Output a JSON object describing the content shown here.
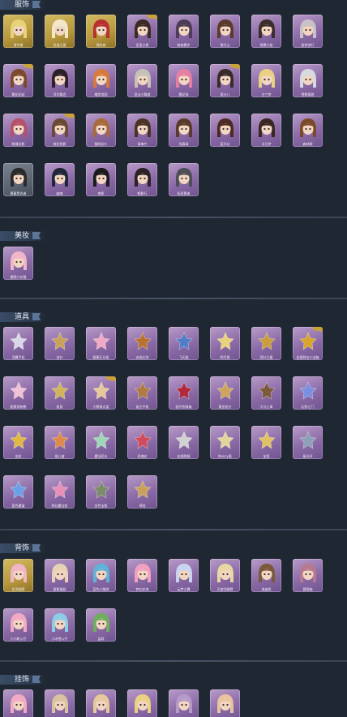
{
  "sections": [
    {
      "title": "服饰",
      "items": [
        {
          "label": "清华黛",
          "frame": "gold",
          "art": "costume",
          "hair": "#e7d27a",
          "badge": false
        },
        {
          "label": "圣诞之喜",
          "frame": "gold",
          "art": "costume",
          "hair": "#f3e7c9",
          "badge": false
        },
        {
          "label": "锦衣夜",
          "frame": "gold",
          "art": "costume",
          "hair": "#b8302f",
          "badge": false
        },
        {
          "label": "亚里沙星",
          "frame": "purple",
          "art": "costume",
          "hair": "#3b2b22",
          "badge": true
        },
        {
          "label": "暗夜舞步",
          "frame": "purple",
          "art": "costume",
          "hair": "#4d3c55",
          "badge": false
        },
        {
          "label": "雪月山",
          "frame": "purple",
          "art": "costume",
          "hair": "#5a3a2a",
          "badge": false
        },
        {
          "label": "猎鹰小姐",
          "frame": "purple",
          "art": "costume",
          "hair": "#3a2d2a",
          "badge": false
        },
        {
          "label": "甜梦游行",
          "frame": "purple",
          "art": "costume",
          "hair": "#c8c1c7",
          "badge": false
        },
        {
          "label": "繁花初绽",
          "frame": "purple",
          "art": "costume",
          "hair": "#7b4a2d",
          "badge": true
        },
        {
          "label": "浮华舞会",
          "frame": "purple",
          "art": "costume",
          "hair": "#2b2028",
          "badge": false
        },
        {
          "label": "橘梦游园",
          "frame": "purple",
          "art": "costume",
          "hair": "#d97a3d",
          "badge": false
        },
        {
          "label": "圣洁小舞娘",
          "frame": "purple",
          "art": "costume",
          "hair": "#c5c1b8",
          "badge": false
        },
        {
          "label": "樱花洛",
          "frame": "purple",
          "art": "costume",
          "hair": "#e47fa3",
          "badge": false
        },
        {
          "label": "诡计八",
          "frame": "purple",
          "art": "costume",
          "hair": "#3a2b2b",
          "badge": true
        },
        {
          "label": "白兰梦",
          "frame": "purple",
          "art": "costume",
          "hair": "#e9d083",
          "badge": false
        },
        {
          "label": "雪影狐娘",
          "frame": "purple",
          "art": "costume",
          "hair": "#d6d9e0",
          "badge": false
        },
        {
          "label": "粉蝶花影",
          "frame": "purple",
          "art": "costume",
          "hair": "#b5516b",
          "badge": false
        },
        {
          "label": "绒毛兔影",
          "frame": "purple",
          "art": "costume",
          "hair": "#6a4a33",
          "badge": true
        },
        {
          "label": "猫咪女仆",
          "frame": "purple",
          "art": "costume",
          "hair": "#a86a3b",
          "badge": false
        },
        {
          "label": "青梅竹",
          "frame": "purple",
          "art": "costume",
          "hair": "#4a3325",
          "badge": false
        },
        {
          "label": "浅春绿",
          "frame": "purple",
          "art": "costume",
          "hair": "#5a3a2a",
          "badge": false
        },
        {
          "label": "蓝月幻",
          "frame": "purple",
          "art": "costume",
          "hair": "#4a2a22",
          "badge": false
        },
        {
          "label": "半日梦",
          "frame": "purple",
          "art": "costume",
          "hair": "#3a2622",
          "badge": false
        },
        {
          "label": "森林歌",
          "frame": "purple",
          "art": "costume",
          "hair": "#7b4a2a",
          "badge": false
        },
        {
          "label": "晨暮黑衣者",
          "frame": "gray",
          "art": "costume",
          "hair": "#2a2a2a",
          "badge": false
        },
        {
          "label": "幽魂",
          "frame": "purple",
          "art": "costume",
          "hair": "#1e2638",
          "badge": false
        },
        {
          "label": "夜影",
          "frame": "purple",
          "art": "costume",
          "hair": "#1a1a1f",
          "badge": false
        },
        {
          "label": "鹤影行",
          "frame": "purple",
          "art": "costume",
          "hair": "#2a2226",
          "badge": false
        },
        {
          "label": "祈愿舞者",
          "frame": "purple",
          "art": "costume",
          "hair": "#4e4e55",
          "badge": false
        }
      ]
    },
    {
      "title": "美妆",
      "items": [
        {
          "label": "樱桃小花猫",
          "frame": "purple",
          "art": "makeup",
          "hair": "#f0b5c8",
          "badge": false
        }
      ]
    },
    {
      "title": "道具",
      "items": [
        {
          "label": "羽翼手杖",
          "frame": "purple",
          "art": "prop",
          "hair": "#d8d8e8",
          "badge": false
        },
        {
          "label": "金针",
          "frame": "purple",
          "art": "prop",
          "hair": "#c9a25a",
          "badge": false
        },
        {
          "label": "甜蜜乐乐瓶",
          "frame": "purple",
          "art": "prop",
          "hair": "#f2a9c4",
          "badge": false
        },
        {
          "label": "赤焰长剑",
          "frame": "purple",
          "art": "prop",
          "hair": "#b9732f",
          "badge": false
        },
        {
          "label": "飞天链",
          "frame": "purple",
          "art": "prop",
          "hair": "#4f7dc8",
          "badge": false
        },
        {
          "label": "明月镜",
          "frame": "purple",
          "art": "prop",
          "hair": "#e8d37a",
          "badge": false
        },
        {
          "label": "荷叶之露",
          "frame": "purple",
          "art": "prop",
          "hair": "#c99e3a",
          "badge": false
        },
        {
          "label": "金银财宝小宝箱",
          "frame": "purple",
          "art": "prop",
          "hair": "#d9a52f",
          "badge": true
        },
        {
          "label": "甜蜜宠物熊",
          "frame": "purple",
          "art": "prop",
          "hair": "#f1c1d6",
          "badge": false
        },
        {
          "label": "星辰",
          "frame": "purple",
          "art": "prop",
          "hair": "#d1b35c",
          "badge": false
        },
        {
          "label": "小熊餐点盘",
          "frame": "purple",
          "art": "prop",
          "hair": "#e6c89a",
          "badge": true
        },
        {
          "label": "复古手枪",
          "frame": "purple",
          "art": "prop",
          "hair": "#b07a42",
          "badge": false
        },
        {
          "label": "医疗急救箱",
          "frame": "purple",
          "art": "prop",
          "hair": "#b3283a",
          "badge": false
        },
        {
          "label": "黄金短刃",
          "frame": "purple",
          "art": "prop",
          "hair": "#cda55a",
          "badge": false
        },
        {
          "label": "大马士革",
          "frame": "purple",
          "art": "prop",
          "hair": "#7c5a3a",
          "badge": false
        },
        {
          "label": "幻梦之门",
          "frame": "purple",
          "art": "prop",
          "hair": "#7a8fe0",
          "badge": false
        },
        {
          "label": "金杖",
          "frame": "purple",
          "art": "prop",
          "hair": "#e0b842",
          "badge": false
        },
        {
          "label": "爱心盒",
          "frame": "purple",
          "art": "prop",
          "hair": "#e08a4a",
          "badge": false
        },
        {
          "label": "魔法药水",
          "frame": "purple",
          "art": "prop",
          "hair": "#9fd6b8",
          "badge": false
        },
        {
          "label": "玫瑰花",
          "frame": "purple",
          "art": "prop",
          "hair": "#d24b5a",
          "badge": false
        },
        {
          "label": "金框眼镜",
          "frame": "purple",
          "art": "prop",
          "hair": "#d2d2d2",
          "badge": false
        },
        {
          "label": "Nancy瓶",
          "frame": "purple",
          "art": "prop",
          "hair": "#e4d49a",
          "badge": false
        },
        {
          "label": "宝塔",
          "frame": "purple",
          "art": "prop",
          "hair": "#e0c262",
          "badge": false
        },
        {
          "label": "星光环",
          "frame": "purple",
          "art": "prop",
          "hair": "#8ea0b8",
          "badge": false
        },
        {
          "label": "蓝色魔盒",
          "frame": "purple",
          "art": "prop",
          "hair": "#6aa0e6",
          "badge": false
        },
        {
          "label": "梦幻魔法杖",
          "frame": "purple",
          "art": "prop",
          "hair": "#e88fb8",
          "badge": false
        },
        {
          "label": "金色宝瓶",
          "frame": "purple",
          "art": "prop",
          "hair": "#7c8b68",
          "badge": false
        },
        {
          "label": "琴弦",
          "frame": "purple",
          "art": "prop",
          "hair": "#c9a25a",
          "badge": false
        }
      ]
    },
    {
      "title": "背饰",
      "items": [
        {
          "label": "金羽翅膀",
          "frame": "gold",
          "art": "back",
          "hair": "#f0b5c8",
          "badge": false
        },
        {
          "label": "甜蜜蛋糕",
          "frame": "purple",
          "art": "back",
          "hair": "#e8d2b5",
          "badge": false
        },
        {
          "label": "蓝色小猫咪",
          "frame": "purple",
          "art": "back",
          "hair": "#5fb3d9",
          "badge": false
        },
        {
          "label": "梦幻花束",
          "frame": "purple",
          "art": "back",
          "hair": "#f2a0c0",
          "badge": false
        },
        {
          "label": "云梦之翼",
          "frame": "purple",
          "art": "back",
          "hair": "#c8d4ee",
          "badge": false
        },
        {
          "label": "天使羽翅膀",
          "frame": "purple",
          "art": "back",
          "hair": "#e7d7a1",
          "badge": false
        },
        {
          "label": "海盗帆",
          "frame": "purple",
          "art": "back",
          "hair": "#7a5a3a",
          "badge": false
        },
        {
          "label": "蔷薇箱",
          "frame": "purple",
          "art": "back",
          "hair": "#b67a8e",
          "badge": false
        },
        {
          "label": "小小粉公仔",
          "frame": "purple",
          "art": "back",
          "hair": "#f2a9c4",
          "badge": false
        },
        {
          "label": "小冰雪公仔",
          "frame": "purple",
          "art": "back",
          "hair": "#8dcde8",
          "badge": false
        },
        {
          "label": "盆栽",
          "frame": "purple",
          "art": "back",
          "hair": "#6fae5a",
          "badge": false
        }
      ]
    },
    {
      "title": "挂饰",
      "items": [
        {
          "label": "",
          "frame": "purple",
          "art": "hang",
          "hair": "#f2a9c4",
          "badge": false
        },
        {
          "label": "",
          "frame": "purple",
          "art": "hang",
          "hair": "#d9c2a0",
          "badge": false
        },
        {
          "label": "",
          "frame": "purple",
          "art": "hang",
          "hair": "#e6c89a",
          "badge": false
        },
        {
          "label": "",
          "frame": "purple",
          "art": "hang",
          "hair": "#e9d083",
          "badge": false
        },
        {
          "label": "",
          "frame": "purple",
          "art": "hang",
          "hair": "#b69ac8",
          "badge": false
        },
        {
          "label": "",
          "frame": "purple",
          "art": "hang",
          "hair": "#e8c3a0",
          "badge": false
        }
      ]
    }
  ],
  "colors": {
    "background": "#1f2733",
    "header_bar": "#3a4d66",
    "tile_purple": "#9a7bb6",
    "tile_gold": "#c7ab4e",
    "tile_gray": "#656d7b"
  }
}
